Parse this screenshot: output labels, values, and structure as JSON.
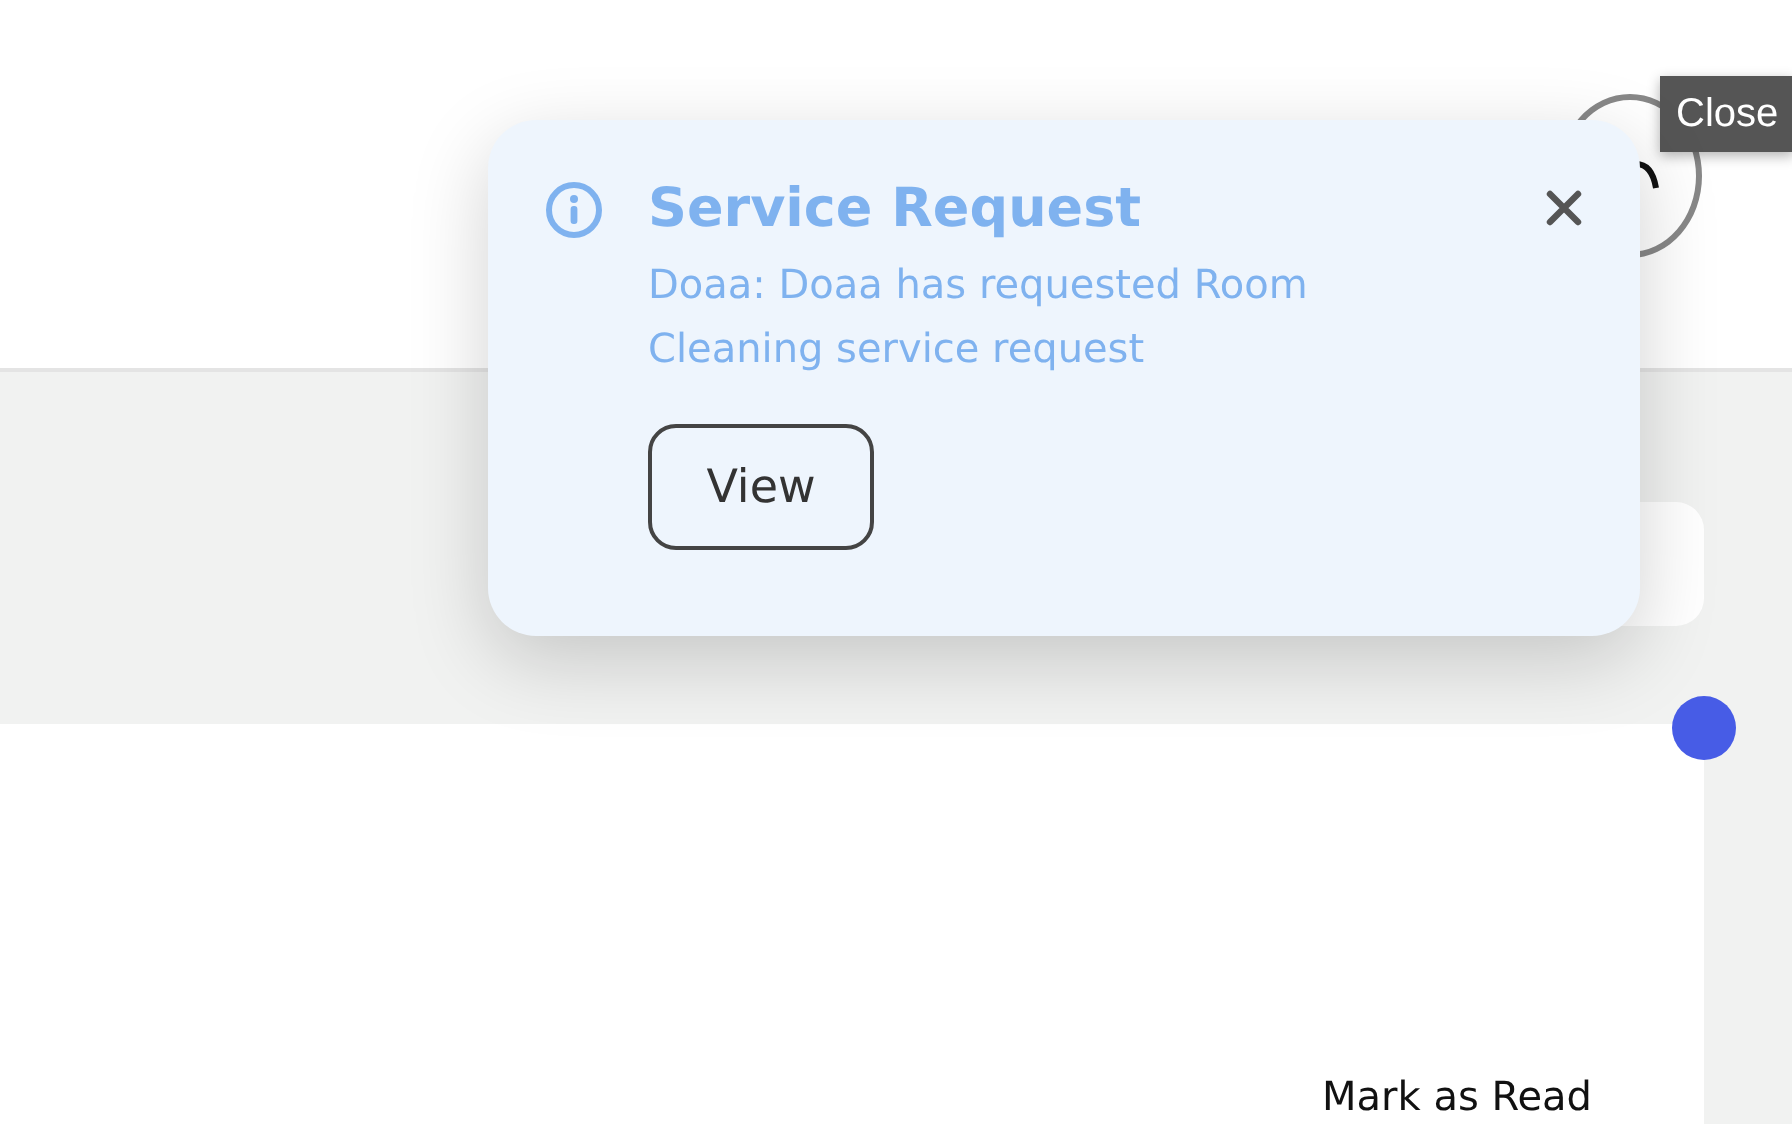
{
  "card": {
    "action": "Mark as Read"
  },
  "tooltip": {
    "text": "Close"
  },
  "toast": {
    "kind": "info",
    "title": "Service Request",
    "message": "Doaa: Doaa has requested Room Cleaning service request",
    "button": "View"
  }
}
